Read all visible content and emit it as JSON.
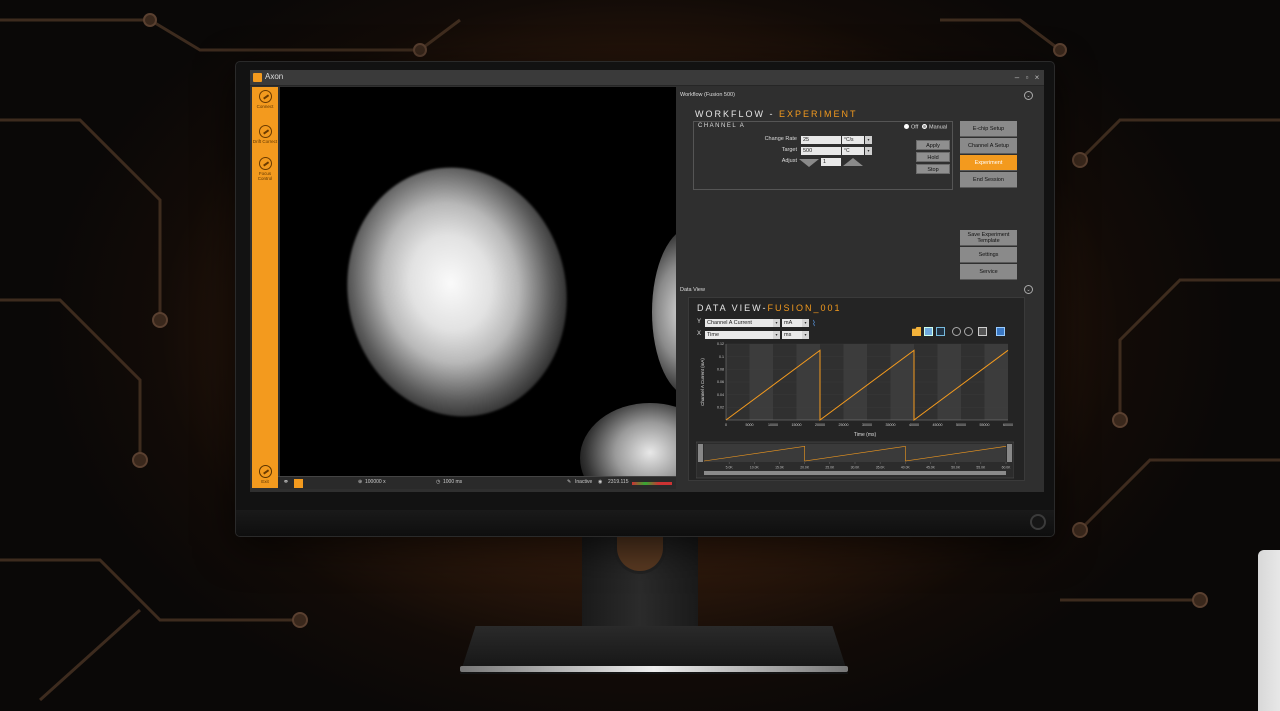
{
  "app": {
    "title": "Axon"
  },
  "sidebar": {
    "items": [
      {
        "label": "Connect",
        "icon": "connect-icon"
      },
      {
        "label": "Drift Correct",
        "icon": "drift-correct-icon"
      },
      {
        "label": "Focus Control",
        "icon": "focus-control-icon"
      }
    ],
    "exit_label": "Exit"
  },
  "viewer_bar": {
    "magnification": "100000 x",
    "exposure": "1000 ms",
    "status": "Inactive",
    "readout": "2319.115"
  },
  "workflow": {
    "panel_title": "Workflow (Fusion 500)",
    "heading_prefix": "WORKFLOW - ",
    "heading_accent": "EXPERIMENT",
    "channel_label": "CHANNEL A",
    "mode_off": "Off",
    "mode_manual": "Manual",
    "change_rate_label": "Change Rate",
    "change_rate_value": "25",
    "change_rate_unit": "°C/s",
    "target_label": "Target",
    "target_value": "500",
    "target_unit": "°C",
    "adjust_label": "Adjust",
    "adjust_value": "1",
    "buttons": {
      "apply": "Apply",
      "hold": "Hold",
      "stop": "Stop"
    },
    "steps": [
      "E-chip Setup",
      "Channel A Setup",
      "Experiment",
      "End Session"
    ],
    "active_step": "Experiment",
    "extra_buttons": [
      "Save Experiment Template",
      "Settings",
      "Service"
    ]
  },
  "data_view": {
    "panel_title": "Data View",
    "heading_prefix": "DATA VIEW-",
    "heading_accent": "FUSION_001",
    "y_axis_label": "Y",
    "y_select": "Channel A Current",
    "y_unit": "mA",
    "x_axis_label": "X",
    "x_select": "Time",
    "x_unit": "ms"
  },
  "colors": {
    "accent": "#f39a1e",
    "panel": "#2f2f2f",
    "button": "#8a8a8a"
  },
  "chart_data": {
    "type": "line",
    "xlabel": "Time (ms)",
    "ylabel": "Channel A Current (mA)",
    "xlim": [
      0,
      60000
    ],
    "ylim": [
      0,
      0.12
    ],
    "xticks": [
      0,
      5000,
      10000,
      15000,
      20000,
      25000,
      30000,
      35000,
      40000,
      45000,
      50000,
      55000,
      60000
    ],
    "yticks": [
      0.02,
      0.04,
      0.06,
      0.08,
      0.1,
      0.12
    ],
    "series": [
      {
        "x": [
          0,
          20000,
          20000,
          40000,
          40000,
          60000
        ],
        "y": [
          0,
          0.11,
          0,
          0.11,
          0,
          0.11
        ]
      }
    ],
    "navigator_ticks": [
      "5.0K",
      "10.0K",
      "15.0K",
      "20.0K",
      "25.0K",
      "30.0K",
      "35.0K",
      "40.0K",
      "45.0K",
      "50.0K",
      "55.0K",
      "60.0K"
    ]
  }
}
